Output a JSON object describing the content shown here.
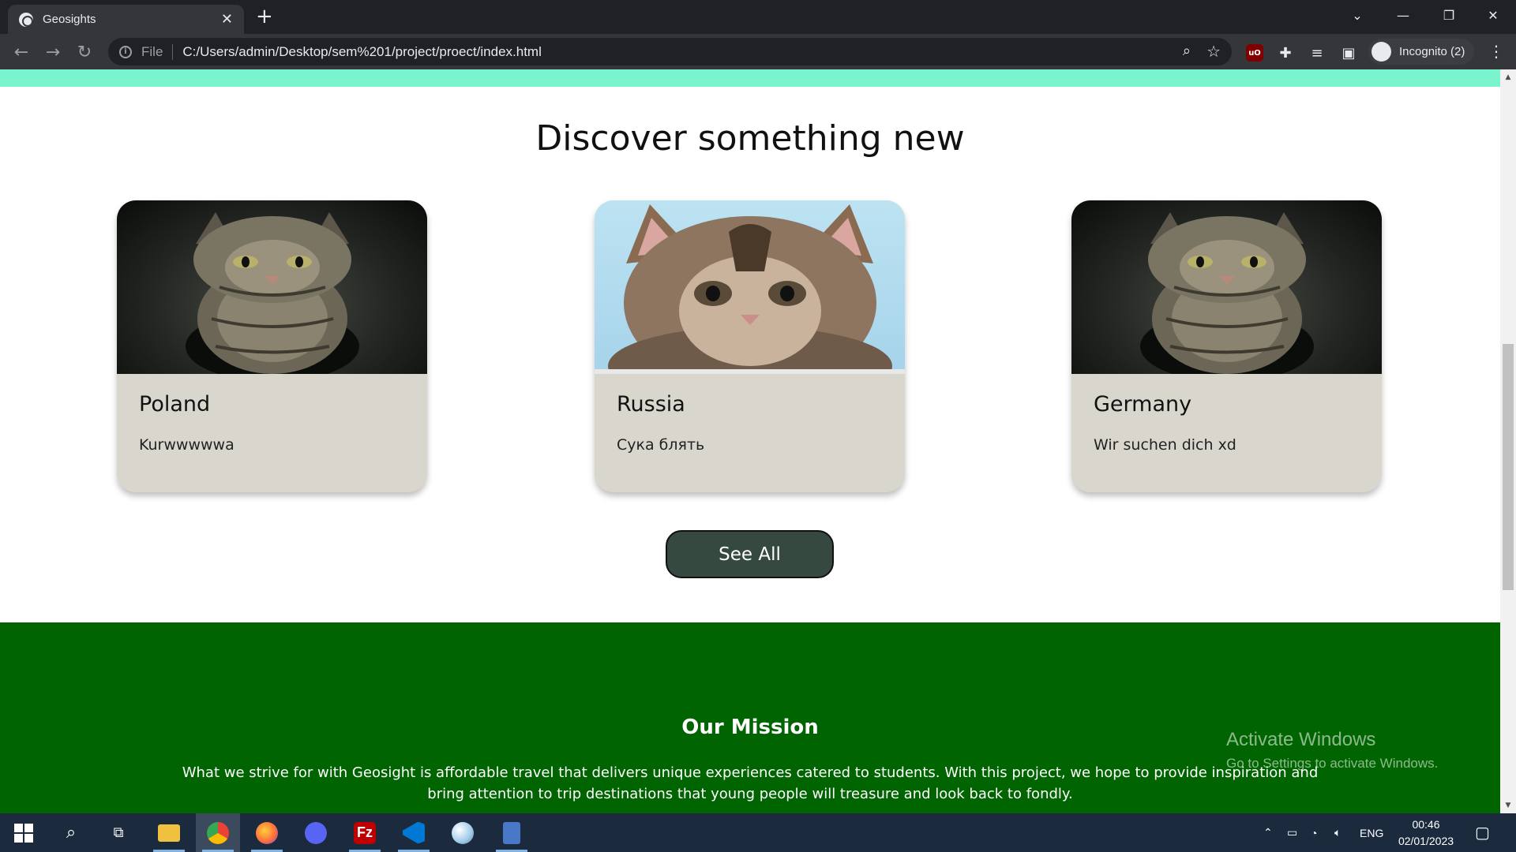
{
  "browser": {
    "tab_title": "Geosights",
    "tab_close": "✕",
    "new_tab": "+",
    "address_scheme_label": "File",
    "url": "C:/Users/admin/Desktop/sem%201/project/proect/index.html",
    "profile_label": "Incognito (2)",
    "window_controls": {
      "tab_search": "⌄",
      "minimize": "—",
      "restore": "❐",
      "close": "✕"
    }
  },
  "page": {
    "heading": "Discover something new",
    "cards": [
      {
        "name": "Poland",
        "description": "Kurwwwwwa",
        "image": "cat-photo"
      },
      {
        "name": "Russia",
        "description": "Сука блять",
        "image": "kitten-photo"
      },
      {
        "name": "Germany",
        "description": "Wir suchen dich xd",
        "image": "cat-photo"
      }
    ],
    "see_all_label": "See All",
    "mission": {
      "title": "Our Mission",
      "text": "What we strive for with Geosight is affordable travel that delivers unique experiences catered to students. With this project, we hope to provide inspiration and bring attention to trip destinations that young people will treasure and look back to fondly."
    },
    "colors": {
      "top_band": "#79f4cf",
      "card_bg": "#d9d7cd",
      "button_bg": "#354941",
      "mission_bg": "#006400"
    }
  },
  "watermark": {
    "line1": "Activate Windows",
    "line2": "Go to Settings to activate Windows."
  },
  "taskbar": {
    "apps": [
      "start",
      "search",
      "task-view",
      "file-explorer",
      "chrome",
      "firefox",
      "discord",
      "filezilla",
      "vscode",
      "paint",
      "calculator"
    ],
    "language": "ENG",
    "time": "00:46",
    "date": "02/01/2023"
  }
}
